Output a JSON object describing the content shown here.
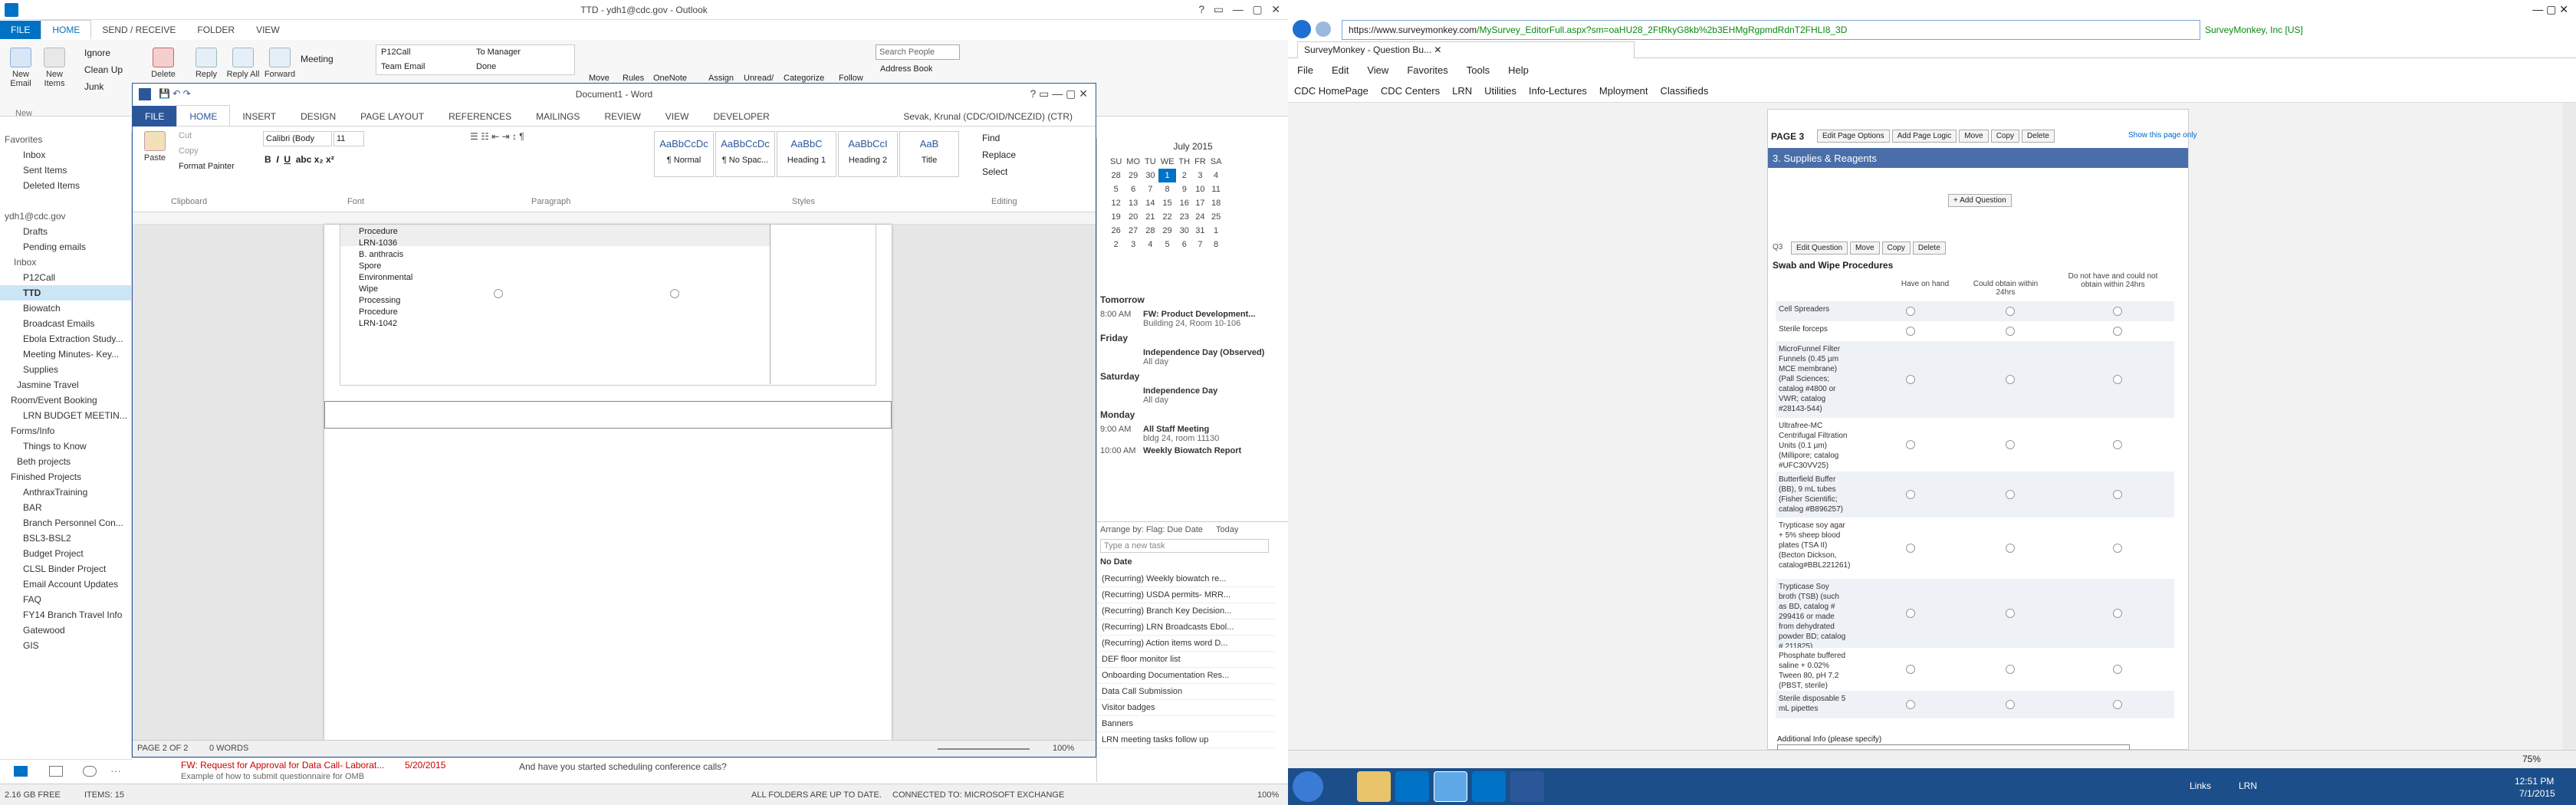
{
  "outlook": {
    "title": "TTD - ydh1@cdc.gov - Outlook",
    "tabs": [
      "FILE",
      "HOME",
      "SEND / RECEIVE",
      "FOLDER",
      "VIEW"
    ],
    "active_tab": "HOME",
    "ribbon": {
      "new_email": "New Email",
      "new_items": "New Items",
      "ignore": "Ignore",
      "clean_up": "Clean Up",
      "junk": "Junk",
      "delete": "Delete",
      "reply": "Reply",
      "reply_all": "Reply All",
      "forward": "Forward",
      "meeting": "Meeting",
      "qs1": "P12Call",
      "qs2": "To Manager",
      "qs3": "Team Email",
      "qs4": "Done",
      "move": "Move",
      "rules": "Rules",
      "onenote": "OneNote",
      "assign": "Assign",
      "unread": "Unread/",
      "categorize": "Categorize",
      "follow": "Follow",
      "search_people": "Search People",
      "address_book": "Address Book",
      "group_new": "New"
    },
    "nav": {
      "favorites": "Favorites",
      "fav_items": [
        "Inbox",
        "Sent Items",
        "Deleted Items"
      ],
      "account": "ydh1@cdc.gov",
      "folders": [
        "Drafts",
        "Pending emails"
      ],
      "inbox": "Inbox",
      "inbox_items": [
        "P12Call",
        "TTD",
        "Biowatch",
        "Broadcast Emails",
        "Ebola Extraction Study...",
        "Meeting Minutes- Key...",
        "Supplies"
      ],
      "more": [
        "Jasmine Travel"
      ],
      "room": "Room/Event Booking",
      "room_items": [
        "LRN BUDGET MEETIN..."
      ],
      "forms": "Forms/Info",
      "forms_items": [
        "Things to Know"
      ],
      "beth": "Beth projects",
      "finished": "Finished Projects",
      "finished_items": [
        "AnthraxTraining",
        "BAR",
        "Branch Personnel Con...",
        "BSL3-BSL2",
        "Budget Project",
        "CLSL Binder Project",
        "Email Account Updates",
        "FAQ",
        "FY14 Branch Travel Info",
        "Gatewood",
        "GIS"
      ]
    },
    "status": {
      "free": "2.16 GB FREE",
      "items": "ITEMS: 15",
      "uptodate": "ALL FOLDERS ARE UP TO DATE.",
      "connected": "CONNECTED TO: MICROSOFT EXCHANGE",
      "zoom": "100%"
    },
    "message": {
      "subject": "FW: Request for Approval for Data Call- Laborat...",
      "date": "5/20/2015",
      "preview": "Example of how to submit questionnaire for OMB",
      "reading": "And have you started scheduling conference calls?"
    },
    "calendar": {
      "month": "July 2015",
      "days": [
        "SU",
        "MO",
        "TU",
        "WE",
        "TH",
        "FR",
        "SA"
      ],
      "weeks": [
        [
          "28",
          "29",
          "30",
          "1",
          "2",
          "3",
          "4"
        ],
        [
          "5",
          "6",
          "7",
          "8",
          "9",
          "10",
          "11"
        ],
        [
          "12",
          "13",
          "14",
          "15",
          "16",
          "17",
          "18"
        ],
        [
          "19",
          "20",
          "21",
          "22",
          "23",
          "24",
          "25"
        ],
        [
          "26",
          "27",
          "28",
          "29",
          "30",
          "31",
          "1"
        ],
        [
          "2",
          "3",
          "4",
          "5",
          "6",
          "7",
          "8"
        ]
      ],
      "today": "1"
    },
    "agenda": [
      {
        "heading": "Tomorrow",
        "time": "8:00 AM",
        "title": "FW: Product Development...",
        "place": "Building 24, Room 10-106"
      },
      {
        "heading": "Friday",
        "time": "",
        "title": "Independence Day (Observed)",
        "place": "All day"
      },
      {
        "heading": "Saturday",
        "time": "",
        "title": "Independence Day",
        "place": "All day"
      },
      {
        "heading": "Monday",
        "time": "9:00 AM",
        "title": "All Staff Meeting",
        "place": "bldg 24, room 11130"
      },
      {
        "heading": "",
        "time": "10:00 AM",
        "title": "Weekly Biowatch Report",
        "place": ""
      }
    ],
    "tasks": {
      "arrange": "Arrange by: Flag: Due Date",
      "today": "Today",
      "placeholder": "Type a new task",
      "no_date": "No Date",
      "items": [
        "(Recurring) Weekly biowatch re...",
        "(Recurring) USDA permits- MRR...",
        "(Recurring) Branch Key Decision...",
        "(Recurring) LRN Broadcasts Ebol...",
        "(Recurring) Action items word D...",
        "DEF floor monitor list",
        "Onboarding Documentation Res...",
        "Data Call Submission",
        "Visitor badges",
        "Banners",
        "LRN meeting tasks follow up"
      ]
    }
  },
  "word": {
    "title": "Document1 - Word",
    "user": "Sevak, Krunal (CDC/OID/NCEZID) (CTR)",
    "tabs": [
      "FILE",
      "HOME",
      "INSERT",
      "DESIGN",
      "PAGE LAYOUT",
      "REFERENCES",
      "MAILINGS",
      "REVIEW",
      "VIEW",
      "DEVELOPER"
    ],
    "active_tab": "HOME",
    "clipboard": {
      "paste": "Paste",
      "cut": "Cut",
      "copy": "Copy",
      "format_painter": "Format Painter",
      "label": "Clipboard"
    },
    "font": {
      "name": "Calibri (Body",
      "size": "11",
      "label": "Font"
    },
    "paragraph_label": "Paragraph",
    "styles": [
      {
        "preview": "AaBbCcDc",
        "name": "¶ Normal"
      },
      {
        "preview": "AaBbCcDc",
        "name": "¶ No Spac..."
      },
      {
        "preview": "AaBbC",
        "name": "Heading 1"
      },
      {
        "preview": "AaBbCcI",
        "name": "Heading 2"
      },
      {
        "preview": "AaB",
        "name": "Title"
      }
    ],
    "styles_label": "Styles",
    "editing": {
      "find": "Find",
      "replace": "Replace",
      "select": "Select",
      "label": "Editing"
    },
    "doc_lines": [
      "Procedure",
      "LRN-1036",
      "B. anthracis",
      "Spore",
      "Environmental",
      "Wipe",
      "Processing",
      "Procedure",
      "LRN-1042"
    ],
    "status": {
      "page": "PAGE 2 OF 2",
      "words": "0 WORDS",
      "zoom": "100%"
    }
  },
  "ie": {
    "url_host": "https://www.surveymonkey.com",
    "url_path": "/MySurvey_EditorFull.aspx?sm=oaHU28_2FtRkyG8kb%2b3EHMgRgpmdRdnT2FHLI8_3D",
    "site": "SurveyMonkey, Inc [US]",
    "tab_title": "SurveyMonkey - Question Bu...",
    "menu": [
      "File",
      "Edit",
      "View",
      "Favorites",
      "Tools",
      "Help"
    ],
    "favorites": [
      "CDC HomePage",
      "CDC Centers",
      "LRN",
      "Utilities",
      "Info-Lectures",
      "Mployment",
      "Classifieds"
    ],
    "zoom": "75%",
    "survey": {
      "page_label": "PAGE 3",
      "page_buttons": [
        "Edit Page Options",
        "Add Page Logic",
        "Move",
        "Copy",
        "Delete"
      ],
      "show_page": "Show this page only",
      "section": "3. Supplies & Reagents",
      "add_question": "+ Add Question",
      "q_label": "Q3",
      "q_buttons": [
        "Edit Question",
        "Move",
        "Copy",
        "Delete"
      ],
      "q_title": "Swab and Wipe Procedures",
      "columns": [
        "Have on hand",
        "Could obtain within 24hrs",
        "Do not have and could not obtain within 24hrs"
      ],
      "rows": [
        "Cell Spreaders",
        "Sterile forceps",
        "MicroFunnel Filter Funnels (0.45 µm MCE membrane) (Pall Sciences; catalog #4800 or VWR; catalog #28143-544)",
        "Ultrafree-MC Centrifugal Filtration Units (0.1 µm) (Millipore; catalog #UFC30VV25)",
        "Butterfield Buffer (BB), 9 mL tubes (Fisher Scientific; catalog #B896257)",
        "Trypticase soy agar + 5% sheep blood plates (TSA II) (Becton Dickson, catalog#BBL221261)",
        "Trypticase Soy broth (TSB) (such as BD, catalog # 299416 or made from dehydrated powder BD; catalog # 211825)",
        "Phosphate buffered saline + 0.02% Tween 80, pH 7.2 (PBST, sterile)",
        "Sterile disposable 5 mL pipettes"
      ],
      "additional": "Additional Info (please specify)"
    }
  },
  "taskbar": {
    "links": "Links",
    "lrn": "LRN",
    "time": "12:51 PM",
    "date": "7/1/2015"
  },
  "colors": {
    "outlook_blue": "#0072c6",
    "word_blue": "#2b579a",
    "survey_header": "#4a6ea9",
    "taskbar": "#1c4f8a"
  }
}
